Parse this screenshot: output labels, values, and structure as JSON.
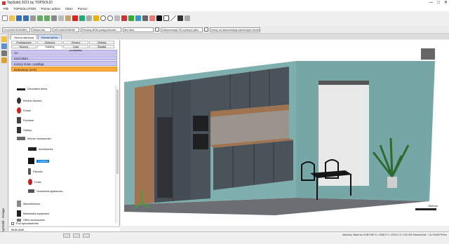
{
  "window": {
    "title": "TopSolid 2021 by TOPSOLID",
    "controls": [
      "—",
      "□",
      "✕"
    ]
  },
  "menu": [
    "Plik",
    "TOPSOLUTION",
    "Pomoc admin",
    "Okno",
    "Pomoc"
  ],
  "toolbar2": {
    "field1": "C0:u/ZAKOSOK/ME5",
    "field2": "Widoki dok.",
    "field3": "VE5:UWOZNIENIE",
    "field4": "Pierwszy BOM podlog kierunku",
    "field5": "Bez klina",
    "field6": "Dokumentacja ZD w jednym pliku",
    "field7": "Kolory na dokumentacje zamiennych elementow"
  },
  "doc_tabs": [
    "Strona startowa",
    "ElementsDoc"
  ],
  "panel": {
    "tabs_row1": [
      "Podstawowe",
      "Ulubione",
      "Glowne obszaru",
      "Obiekty"
    ],
    "tabs_row2": [
      "Wzorcy",
      "Katalog",
      "Lista produktów",
      "Światła"
    ],
    "selected_tab": "Katalog",
    "bars": [
      {
        "label": "AA",
        "style": "purple"
      },
      {
        "label": "KUCHNIA",
        "style": "purple"
      },
      {
        "label": "Kolory ścian i podłogi",
        "style": "purple"
      },
      {
        "label": "Dekoracje (373)",
        "style": "orange"
      }
    ],
    "tree": [
      {
        "label": "Decorative items",
        "level": 1
      },
      {
        "label": "Electric devices",
        "level": 1
      },
      {
        "label": "Frame",
        "level": 1
      },
      {
        "label": "Furniture",
        "level": 1
      },
      {
        "label": "Gallery",
        "level": 1
      },
      {
        "label": "Kitchen accessories",
        "level": 1
      },
      {
        "label": "Accessories",
        "level": 2
      },
      {
        "label": "Cookers",
        "level": 2
      },
      {
        "label": "Faucets",
        "level": 2
      },
      {
        "label": "Fruits",
        "level": 2
      },
      {
        "label": "Household appliances",
        "level": 2
      },
      {
        "label": "Miscellaneous",
        "level": 1
      },
      {
        "label": "Multimedia equipment",
        "level": 1
      },
      {
        "label": "Office accessories",
        "level": 1
      }
    ],
    "footer_check": "Pull spreadsheets",
    "multidraft": "Multi-draft"
  },
  "left_rail": {
    "label": "TopSolid · Design"
  },
  "viewport": {
    "scale_label": "500mm"
  },
  "status": {
    "text": "Aktualny układ ws KUB+WE   X=-1068,0  Y=-4010,0  Z=-100,000  Nawodzinie = UU  Suffit+Poles"
  },
  "colors": {
    "accent": "#0078d7",
    "orange_bar": "#ffae3b",
    "purple_bar": "#c9c7ef",
    "wall": "#7faeae",
    "cabinet": "#4a525a",
    "wood": "#a07450"
  }
}
